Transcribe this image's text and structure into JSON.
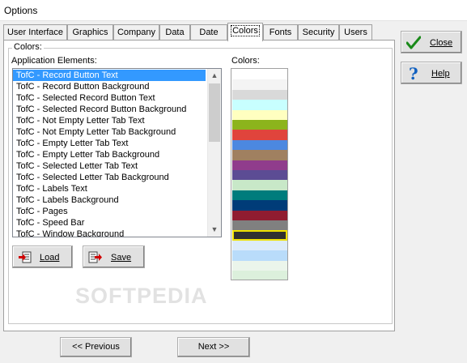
{
  "window": {
    "title": "Options"
  },
  "tabs": [
    {
      "label": "User Interface"
    },
    {
      "label": "Graphics"
    },
    {
      "label": "Company"
    },
    {
      "label": "Data"
    },
    {
      "label": "Date"
    },
    {
      "label": "Colors"
    },
    {
      "label": "Fonts"
    },
    {
      "label": "Security"
    },
    {
      "label": "Users"
    }
  ],
  "active_tab": "Colors",
  "colors_group": {
    "title": "Colors:",
    "app_elements_label": "Application Elements:",
    "colors_label": "Colors:"
  },
  "elements_list": [
    "TofC - Record Button Text",
    "TofC - Record Button Background",
    "TofC - Selected Record Button Text",
    "TofC - Selected Record Button Background",
    "TofC - Not Empty Letter Tab Text",
    "TofC - Not Empty Letter Tab Background",
    "TofC - Empty Letter Tab Text",
    "TofC - Empty Letter Tab Background",
    "TofC - Selected Letter Tab Text",
    "TofC - Selected Letter Tab Background",
    "TofC - Labels Text",
    "TofC - Labels Background",
    "TofC - Pages",
    "TofC - Speed Bar",
    "TofC - Window Background"
  ],
  "selected_element": "TofC - Record Button Text",
  "color_palette": [
    "#ffffff",
    "#f4f4f4",
    "#d9d9d9",
    "#c8ffff",
    "#ffffc0",
    "#8cb41c",
    "#e0443c",
    "#4c88e0",
    "#a08060",
    "#903c8c",
    "#5c4c94",
    "#c8e8c8",
    "#007c7c",
    "#003c78",
    "#901c30",
    "#808080",
    "#303030",
    "#dcebfa",
    "#b9dcfa",
    "#ebf5eb",
    "#dcf0dc"
  ],
  "selected_color": "#303030",
  "buttons": {
    "close": "Close",
    "help": "Help",
    "load": "Load",
    "save": "Save",
    "previous": "<< Previous",
    "next": "Next >>"
  },
  "watermark": "SOFTPEDIA"
}
